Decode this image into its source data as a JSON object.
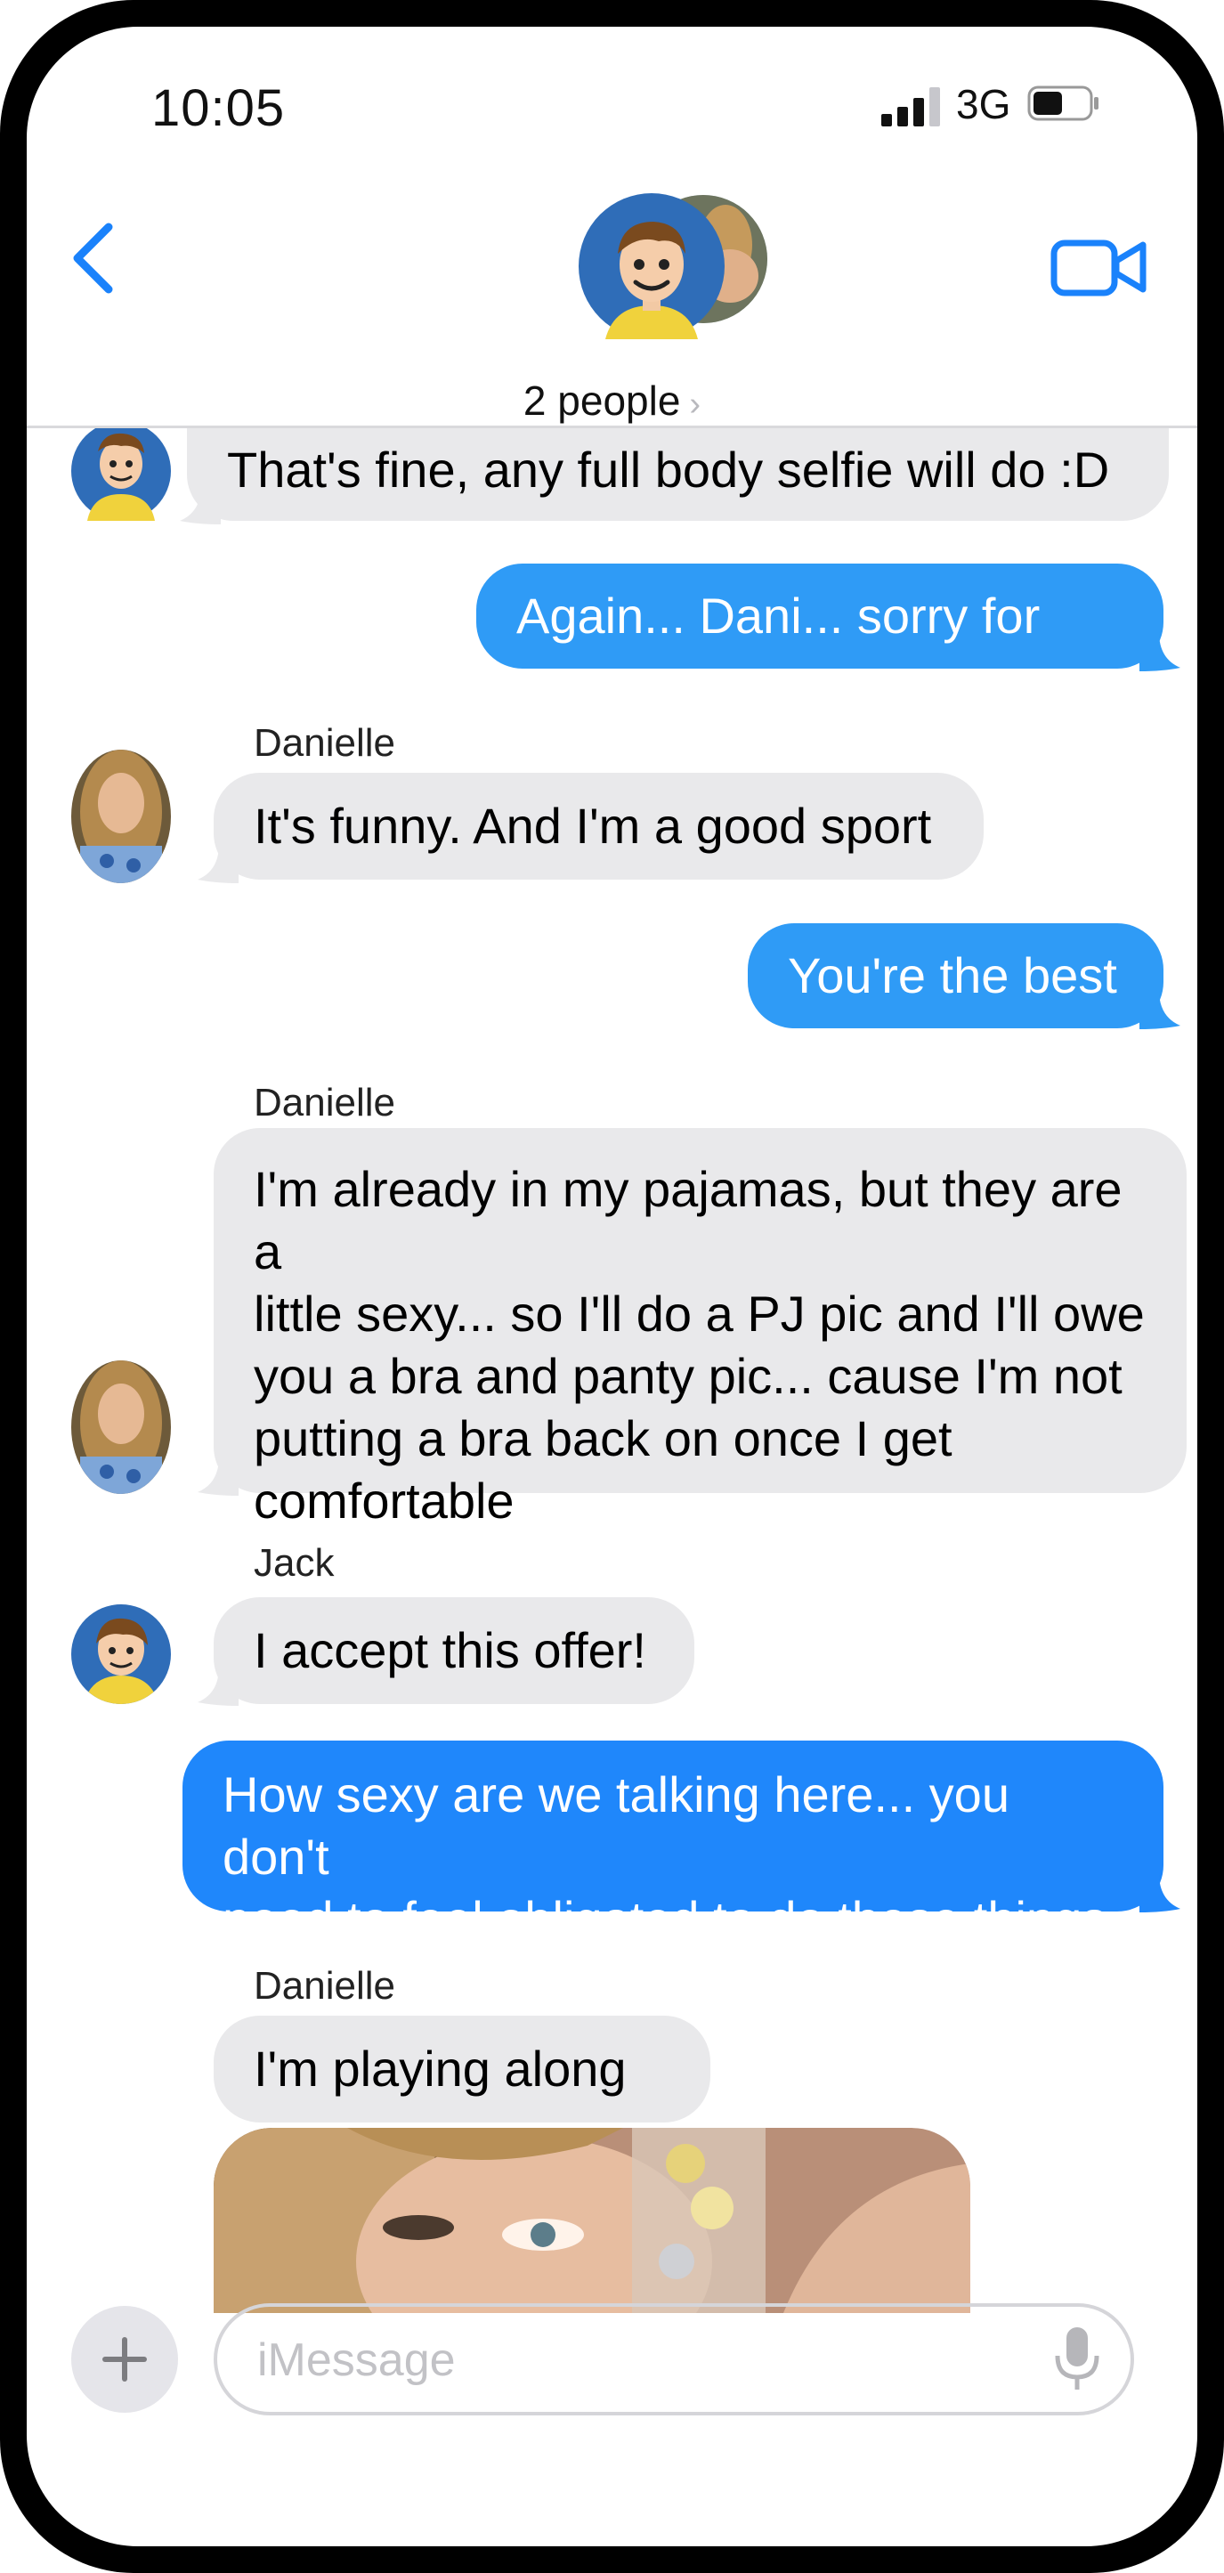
{
  "status_bar": {
    "time": "10:05",
    "network": "3G"
  },
  "header": {
    "people_label": "2 people",
    "chevron": "›",
    "back_icon": "chevron-left-icon",
    "video_icon": "video-camera-icon"
  },
  "messages": [
    {
      "type": "received",
      "sender": "",
      "text": "That's fine, any full body selfie will do :D"
    },
    {
      "type": "sent",
      "text": "Again... Dani... sorry for him"
    },
    {
      "type": "received",
      "sender": "Danielle",
      "text": "It's funny.  And I'm a good sport"
    },
    {
      "type": "sent",
      "text": "You're the best"
    },
    {
      "type": "received",
      "sender": "Danielle",
      "lines": [
        "I'm already in my pajamas, but they are a",
        "little sexy... so I'll do a PJ pic and I'll owe",
        "you a bra and panty pic... cause I'm not",
        "putting a bra back on once I get",
        "comfortable"
      ]
    },
    {
      "type": "received",
      "sender": "Jack",
      "text": "I accept this offer!"
    },
    {
      "type": "sent",
      "lines": [
        "How sexy are we talking here... you don't",
        "need to feel obligated to do these things"
      ]
    },
    {
      "type": "received",
      "sender": "Danielle",
      "text": "I'm playing along :)"
    }
  ],
  "composer": {
    "placeholder": "iMessage",
    "plus_icon": "plus-icon",
    "mic_icon": "microphone-icon"
  },
  "colors": {
    "sent_bubble": "#2f9bf6",
    "sent_bubble_dark": "#1f87fb",
    "received_bubble": "#e9e9eb",
    "accent": "#1a82fb"
  }
}
